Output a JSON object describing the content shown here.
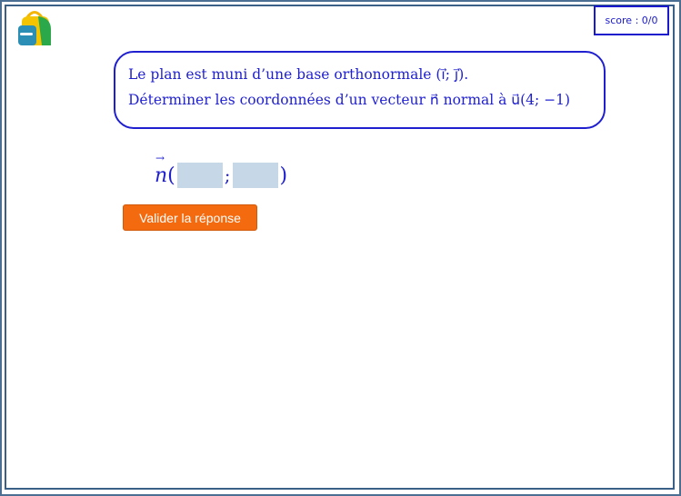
{
  "score": {
    "label": "score : 0/0"
  },
  "question": {
    "line1": "Le plan est muni d’une base orthonormale (i⃗; j⃗).",
    "line2": "Déterminer les coordonnées d’un vecteur n⃗ normal à u⃗(4; −1)"
  },
  "answer": {
    "vector_name": "n",
    "open_paren": "(",
    "separator": ";",
    "close_paren": ")",
    "x_value": "",
    "y_value": ""
  },
  "button": {
    "validate_label": "Valider la réponse"
  },
  "icons": {
    "logo": "backpack-icon"
  },
  "colors": {
    "accent": "#1f1fd0",
    "button": "#f46a0e",
    "input_bg": "#c6d8e8"
  }
}
